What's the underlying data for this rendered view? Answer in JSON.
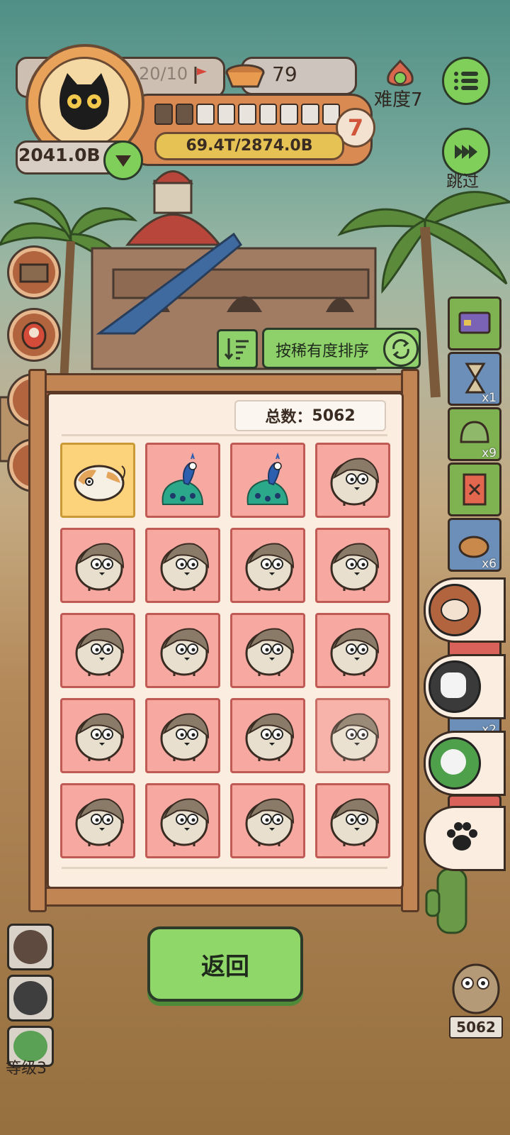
{
  "profile": {
    "progress_count": "20/10",
    "coins": "2041.0B",
    "level_number": "7",
    "level_exp": "69.4T/2874.0B",
    "level_bar_fraction": 0.2
  },
  "food": {
    "amount": "79"
  },
  "difficulty": {
    "label": "难度7"
  },
  "skip": {
    "label": "跳过"
  },
  "sort": {
    "label": "按稀有度排序"
  },
  "collection": {
    "total_label": "总数：",
    "total_value": "5062",
    "grid": [
      [
        "hamster",
        "peacock",
        "peacock",
        "hedgehog"
      ],
      [
        "hedgehog",
        "hedgehog",
        "hedgehog",
        "hedgehog"
      ],
      [
        "hedgehog",
        "hedgehog",
        "hedgehog",
        "hedgehog"
      ],
      [
        "hedgehog",
        "hedgehog",
        "hedgehog",
        "hedgehog"
      ],
      [
        "hedgehog",
        "hedgehog",
        "hedgehog",
        "hedgehog"
      ]
    ]
  },
  "back_button": {
    "label": "返回"
  },
  "right_items": [
    {
      "icon": "card-icon",
      "count": ""
    },
    {
      "icon": "hourglass-shovel-icon",
      "count": "x1"
    },
    {
      "icon": "helmet-icon",
      "count": "x9"
    },
    {
      "icon": "ticket-icon",
      "count": ""
    },
    {
      "icon": "sack-icon",
      "count": "x6"
    }
  ],
  "lower_right_badge": {
    "count": "x2"
  },
  "player_level": {
    "label": "等级3"
  },
  "bottom_right_counter": {
    "value": "5062"
  },
  "colors": {
    "accent_green": "#7fcf5a",
    "cell_pink": "#f7a8a0",
    "cell_gold": "#fcd27b",
    "panel_bg": "#fbeee1"
  }
}
